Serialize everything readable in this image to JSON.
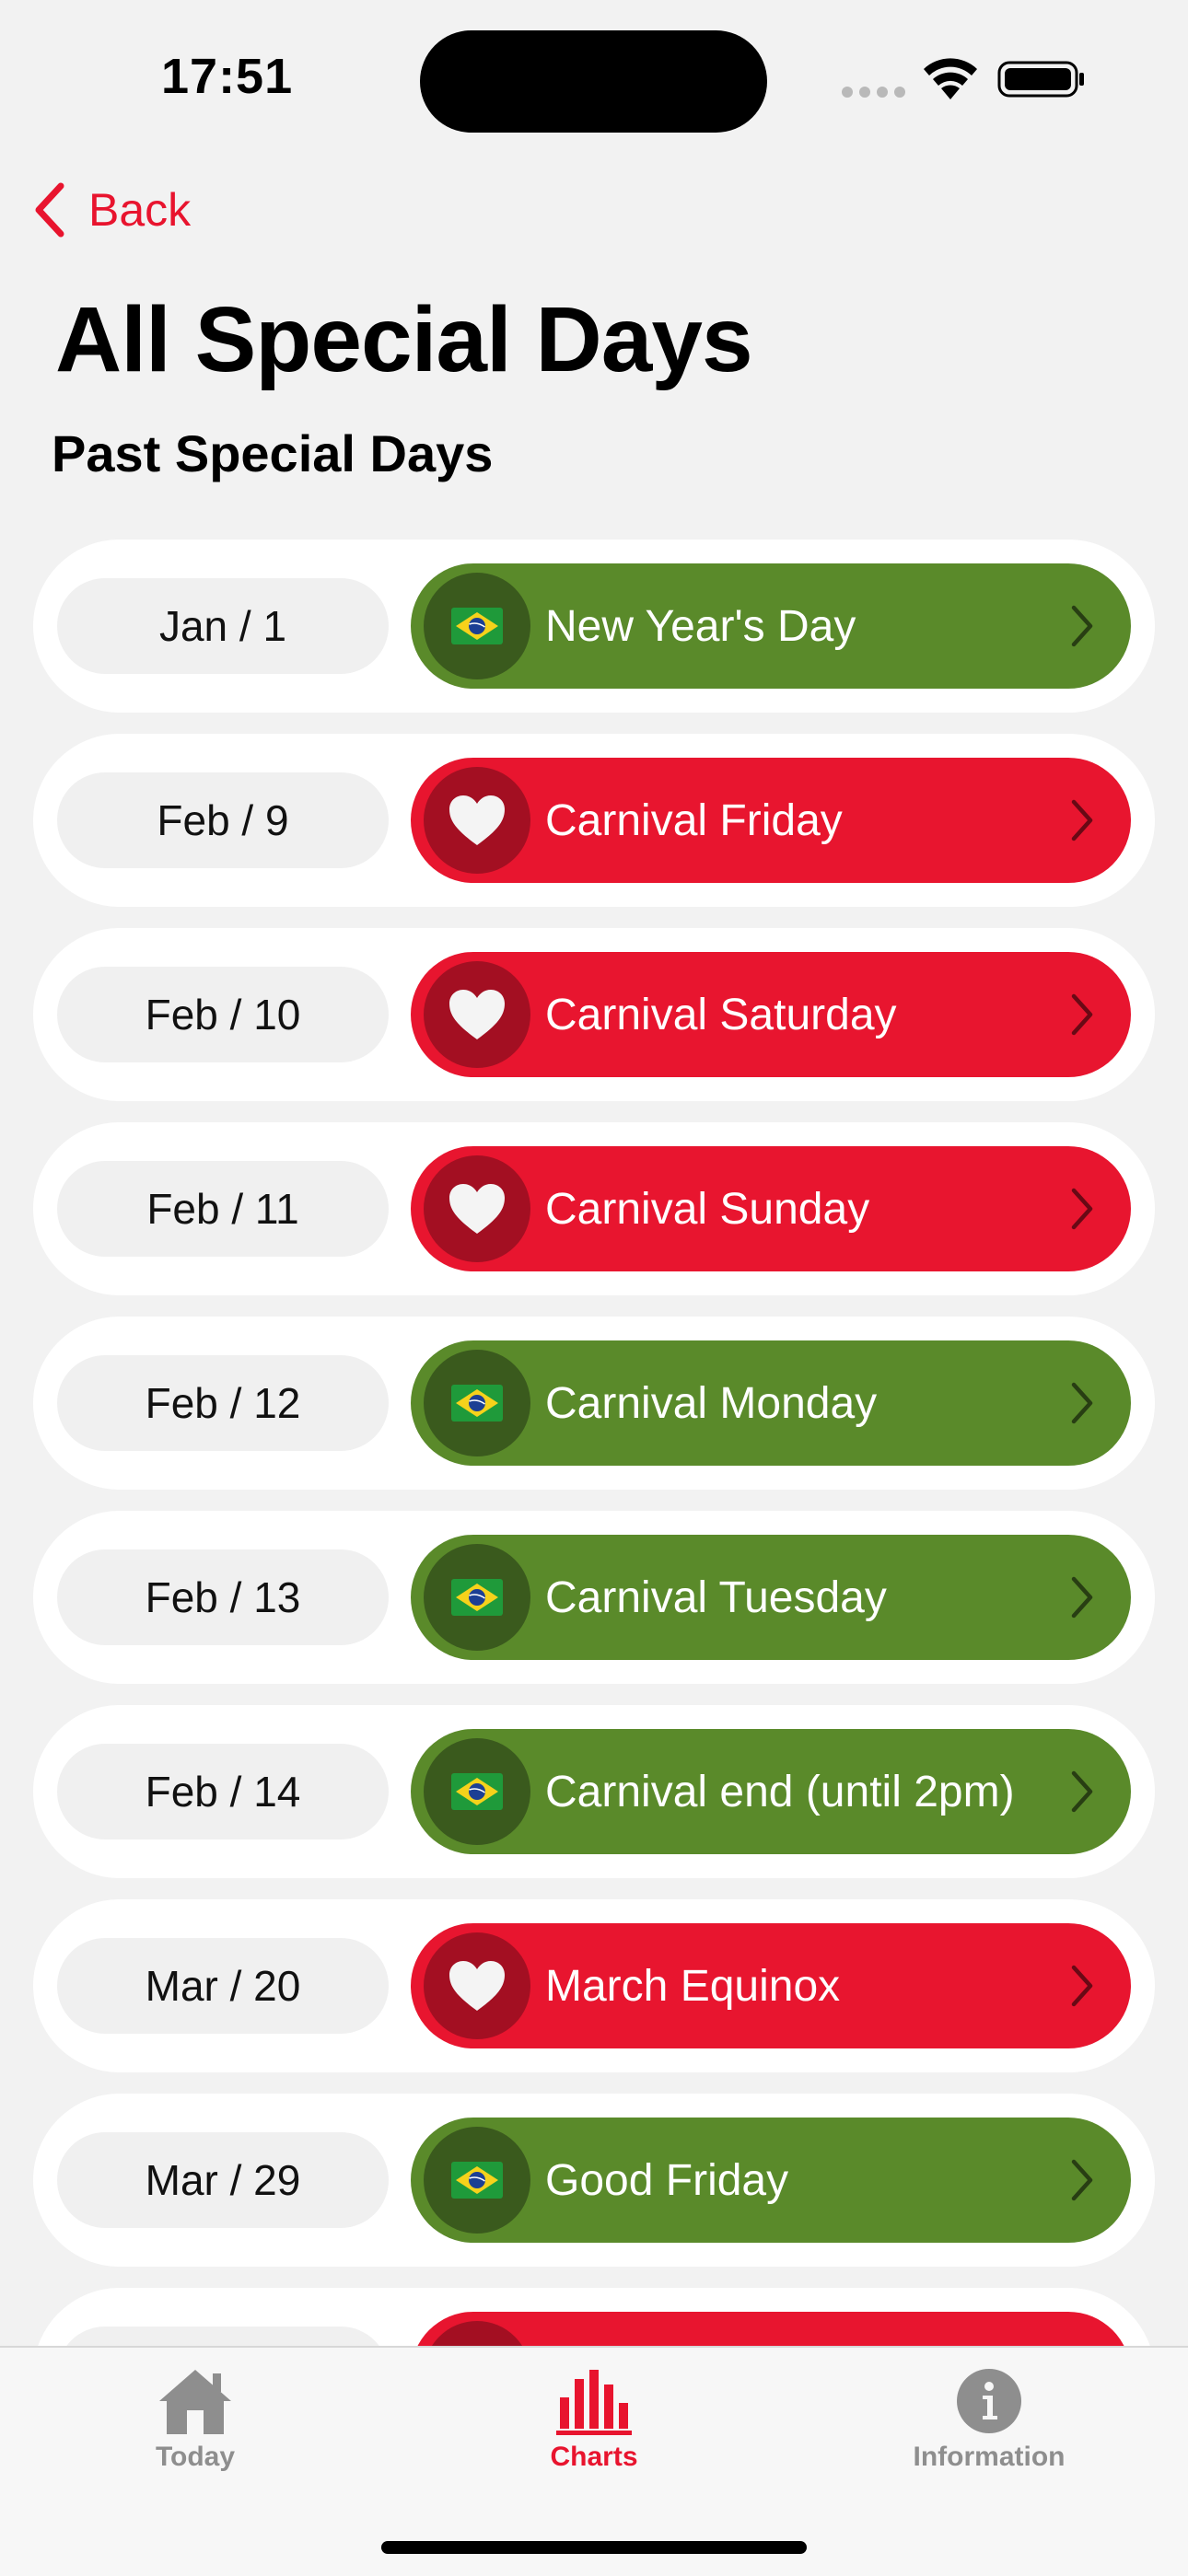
{
  "status_bar": {
    "time": "17:51"
  },
  "nav": {
    "back_label": "Back"
  },
  "page_title": "All Special Days",
  "section_title": "Past Special Days",
  "colors": {
    "accent": "#e8142e",
    "green_pill": "#5a8a2a",
    "red_pill": "#e8152f",
    "background": "#f2f2f2"
  },
  "days": [
    {
      "date": "Jan / 1",
      "name": "New Year's Day",
      "color": "green",
      "icon": "brazil-flag-icon"
    },
    {
      "date": "Feb / 9",
      "name": "Carnival Friday",
      "color": "red",
      "icon": "heart-icon"
    },
    {
      "date": "Feb / 10",
      "name": "Carnival Saturday",
      "color": "red",
      "icon": "heart-icon"
    },
    {
      "date": "Feb / 11",
      "name": "Carnival Sunday",
      "color": "red",
      "icon": "heart-icon"
    },
    {
      "date": "Feb / 12",
      "name": "Carnival Monday",
      "color": "green",
      "icon": "brazil-flag-icon"
    },
    {
      "date": "Feb / 13",
      "name": "Carnival Tuesday",
      "color": "green",
      "icon": "brazil-flag-icon"
    },
    {
      "date": "Feb / 14",
      "name": "Carnival end (until 2pm)",
      "color": "green",
      "icon": "brazil-flag-icon"
    },
    {
      "date": "Mar / 20",
      "name": "March Equinox",
      "color": "red",
      "icon": "heart-icon"
    },
    {
      "date": "Mar / 29",
      "name": "Good Friday",
      "color": "green",
      "icon": "brazil-flag-icon"
    },
    {
      "date": "",
      "name": "",
      "color": "red",
      "icon": "heart-icon"
    }
  ],
  "tab_bar": {
    "tabs": [
      {
        "label": "Today",
        "icon": "house-icon",
        "selected": false
      },
      {
        "label": "Charts",
        "icon": "bar-chart-icon",
        "selected": true
      },
      {
        "label": "Information",
        "icon": "info-icon",
        "selected": false
      }
    ]
  }
}
